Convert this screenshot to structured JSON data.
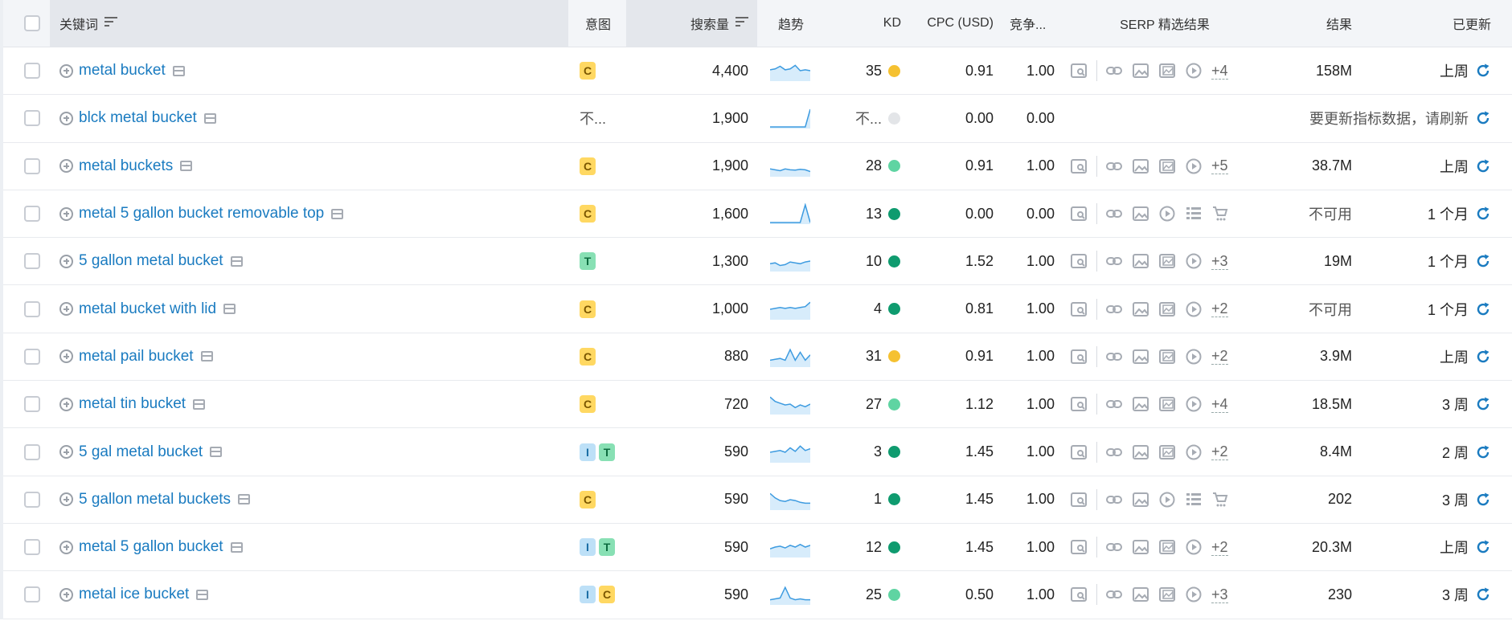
{
  "header": {
    "keyword": "关键词",
    "intent": "意图",
    "volume": "搜索量",
    "trend": "趋势",
    "kd": "KD",
    "cpc": "CPC (USD)",
    "competition": "竞争...",
    "serp": "SERP 精选结果",
    "results": "结果",
    "updated": "已更新"
  },
  "colors": {
    "link": "#1a7bc0",
    "kd_yellow": "#f5c131",
    "kd_light_green": "#5fd4a2",
    "kd_dark_green": "#0f9b6f",
    "kd_gray": "#e3e5e8",
    "refresh": "#1a7bc0"
  },
  "rows": [
    {
      "keyword": "metal bucket",
      "intent": [
        "C"
      ],
      "intent_text": "",
      "volume": "4,400",
      "trend": [
        0.55,
        0.6,
        0.75,
        0.55,
        0.6,
        0.8,
        0.5,
        0.55,
        0.5
      ],
      "kd": "35",
      "kd_color": "#f5c131",
      "cpc": "0.91",
      "competition": "1.00",
      "serp": [
        "zoom-doc-icon",
        "link-icon",
        "image-icon",
        "image-gallery-icon",
        "video-icon"
      ],
      "serp_more": "+4",
      "results": "158M",
      "updated": "上周"
    },
    {
      "keyword": "blck metal bucket",
      "intent": [],
      "intent_text": "不...",
      "volume": "1,900",
      "trend": [
        0,
        0,
        0,
        0,
        0,
        0,
        0,
        0,
        1.0
      ],
      "kd": "不...",
      "kd_color": "#e3e5e8",
      "cpc": "0.00",
      "competition": "0.00",
      "serp": [],
      "serp_more": "",
      "results": "",
      "updated": "要更新指标数据，请刷新"
    },
    {
      "keyword": "metal buckets",
      "intent": [
        "C"
      ],
      "intent_text": "",
      "volume": "1,900",
      "trend": [
        0.35,
        0.3,
        0.25,
        0.35,
        0.3,
        0.28,
        0.33,
        0.3,
        0.2
      ],
      "kd": "28",
      "kd_color": "#5fd4a2",
      "cpc": "0.91",
      "competition": "1.00",
      "serp": [
        "zoom-doc-icon",
        "link-icon",
        "image-icon",
        "image-gallery-icon",
        "video-icon"
      ],
      "serp_more": "+5",
      "results": "38.7M",
      "updated": "上周"
    },
    {
      "keyword": "metal 5 gallon bucket removable top",
      "intent": [
        "C"
      ],
      "intent_text": "",
      "volume": "1,600",
      "trend": [
        0,
        0,
        0,
        0,
        0,
        0,
        0,
        1.0,
        0
      ],
      "kd": "13",
      "kd_color": "#0f9b6f",
      "cpc": "0.00",
      "competition": "0.00",
      "serp": [
        "zoom-doc-icon",
        "link-icon",
        "image-icon",
        "video-icon",
        "list-icon",
        "cart-icon"
      ],
      "serp_more": "",
      "results": "不可用",
      "updated": "1 个月"
    },
    {
      "keyword": "5 gallon metal bucket",
      "intent": [
        "T"
      ],
      "intent_text": "",
      "volume": "1,300",
      "trend": [
        0.35,
        0.4,
        0.25,
        0.3,
        0.45,
        0.4,
        0.35,
        0.45,
        0.5
      ],
      "kd": "10",
      "kd_color": "#0f9b6f",
      "cpc": "1.52",
      "competition": "1.00",
      "serp": [
        "zoom-doc-icon",
        "link-icon",
        "image-icon",
        "image-gallery-icon",
        "video-icon"
      ],
      "serp_more": "+3",
      "results": "19M",
      "updated": "1 个月"
    },
    {
      "keyword": "metal bucket with lid",
      "intent": [
        "C"
      ],
      "intent_text": "",
      "volume": "1,000",
      "trend": [
        0.5,
        0.55,
        0.6,
        0.55,
        0.6,
        0.55,
        0.6,
        0.65,
        0.9
      ],
      "kd": "4",
      "kd_color": "#0f9b6f",
      "cpc": "0.81",
      "competition": "1.00",
      "serp": [
        "zoom-doc-icon",
        "link-icon",
        "image-icon",
        "image-gallery-icon",
        "video-icon"
      ],
      "serp_more": "+2",
      "results": "不可用",
      "updated": "1 个月"
    },
    {
      "keyword": "metal pail bucket",
      "intent": [
        "C"
      ],
      "intent_text": "",
      "volume": "880",
      "trend": [
        0.3,
        0.35,
        0.4,
        0.3,
        0.9,
        0.3,
        0.75,
        0.3,
        0.6
      ],
      "kd": "31",
      "kd_color": "#f5c131",
      "cpc": "0.91",
      "competition": "1.00",
      "serp": [
        "zoom-doc-icon",
        "link-icon",
        "image-icon",
        "image-gallery-icon",
        "video-icon"
      ],
      "serp_more": "+2",
      "results": "3.9M",
      "updated": "上周"
    },
    {
      "keyword": "metal tin bucket",
      "intent": [
        "C"
      ],
      "intent_text": "",
      "volume": "720",
      "trend": [
        0.9,
        0.65,
        0.55,
        0.45,
        0.5,
        0.3,
        0.45,
        0.35,
        0.5
      ],
      "kd": "27",
      "kd_color": "#5fd4a2",
      "cpc": "1.12",
      "competition": "1.00",
      "serp": [
        "zoom-doc-icon",
        "link-icon",
        "image-icon",
        "image-gallery-icon",
        "video-icon"
      ],
      "serp_more": "+4",
      "results": "18.5M",
      "updated": "3 周"
    },
    {
      "keyword": "5 gal metal bucket",
      "intent": [
        "I",
        "T"
      ],
      "intent_text": "",
      "volume": "590",
      "trend": [
        0.5,
        0.55,
        0.6,
        0.5,
        0.75,
        0.55,
        0.85,
        0.6,
        0.7
      ],
      "kd": "3",
      "kd_color": "#0f9b6f",
      "cpc": "1.45",
      "competition": "1.00",
      "serp": [
        "zoom-doc-icon",
        "link-icon",
        "image-icon",
        "image-gallery-icon",
        "video-icon"
      ],
      "serp_more": "+2",
      "results": "8.4M",
      "updated": "2 周"
    },
    {
      "keyword": "5 gallon metal buckets",
      "intent": [
        "C"
      ],
      "intent_text": "",
      "volume": "590",
      "trend": [
        0.85,
        0.6,
        0.45,
        0.4,
        0.5,
        0.45,
        0.35,
        0.3,
        0.3
      ],
      "kd": "1",
      "kd_color": "#0f9b6f",
      "cpc": "1.45",
      "competition": "1.00",
      "serp": [
        "zoom-doc-icon",
        "link-icon",
        "image-icon",
        "video-icon",
        "list-icon",
        "cart-icon"
      ],
      "serp_more": "",
      "results": "202",
      "updated": "3 周"
    },
    {
      "keyword": "metal 5 gallon bucket",
      "intent": [
        "I",
        "T"
      ],
      "intent_text": "",
      "volume": "590",
      "trend": [
        0.4,
        0.5,
        0.55,
        0.45,
        0.6,
        0.5,
        0.65,
        0.5,
        0.6
      ],
      "kd": "12",
      "kd_color": "#0f9b6f",
      "cpc": "1.45",
      "competition": "1.00",
      "serp": [
        "zoom-doc-icon",
        "link-icon",
        "image-icon",
        "image-gallery-icon",
        "video-icon"
      ],
      "serp_more": "+2",
      "results": "20.3M",
      "updated": "上周"
    },
    {
      "keyword": "metal ice bucket",
      "intent": [
        "I",
        "C"
      ],
      "intent_text": "",
      "volume": "590",
      "trend": [
        0.2,
        0.25,
        0.3,
        0.9,
        0.3,
        0.2,
        0.25,
        0.2,
        0.2
      ],
      "kd": "25",
      "kd_color": "#5fd4a2",
      "cpc": "0.50",
      "competition": "1.00",
      "serp": [
        "zoom-doc-icon",
        "link-icon",
        "image-icon",
        "image-gallery-icon",
        "video-icon"
      ],
      "serp_more": "+3",
      "results": "230",
      "updated": "3 周"
    }
  ]
}
